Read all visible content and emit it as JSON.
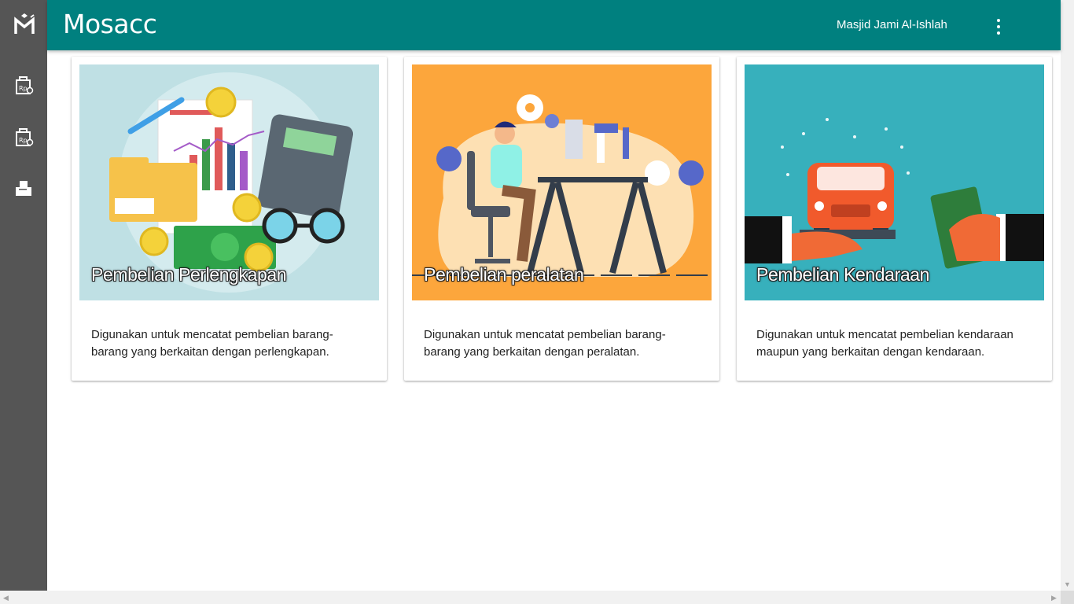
{
  "app": {
    "title": "Mosacc",
    "organization": "Masjid Jami Al-Ishlah"
  },
  "sidebar": {
    "items": [
      {
        "icon": "receipt-icon",
        "label": ""
      },
      {
        "icon": "receipt-icon",
        "label": ""
      },
      {
        "icon": "printer-icon",
        "label": ""
      }
    ]
  },
  "cards": [
    {
      "title": "Pembelian Perlengkapan",
      "description": "Digunakan untuk mencatat pembelian barang-barang yang berkaitan dengan perlengkapan.",
      "image_bg": "#bfe0e4"
    },
    {
      "title": "Pembelian peralatan",
      "description": "Digunakan untuk mencatat pembelian barang-barang yang berkaitan dengan peralatan.",
      "image_bg": "#fca63c"
    },
    {
      "title": "Pembelian Kendaraan",
      "description": "Digunakan untuk mencatat pembelian kendaraan maupun yang berkaitan dengan kendaraan.",
      "image_bg": "#37b0bc"
    }
  ],
  "colors": {
    "appbar": "#00807f",
    "sidebar": "#555555"
  }
}
